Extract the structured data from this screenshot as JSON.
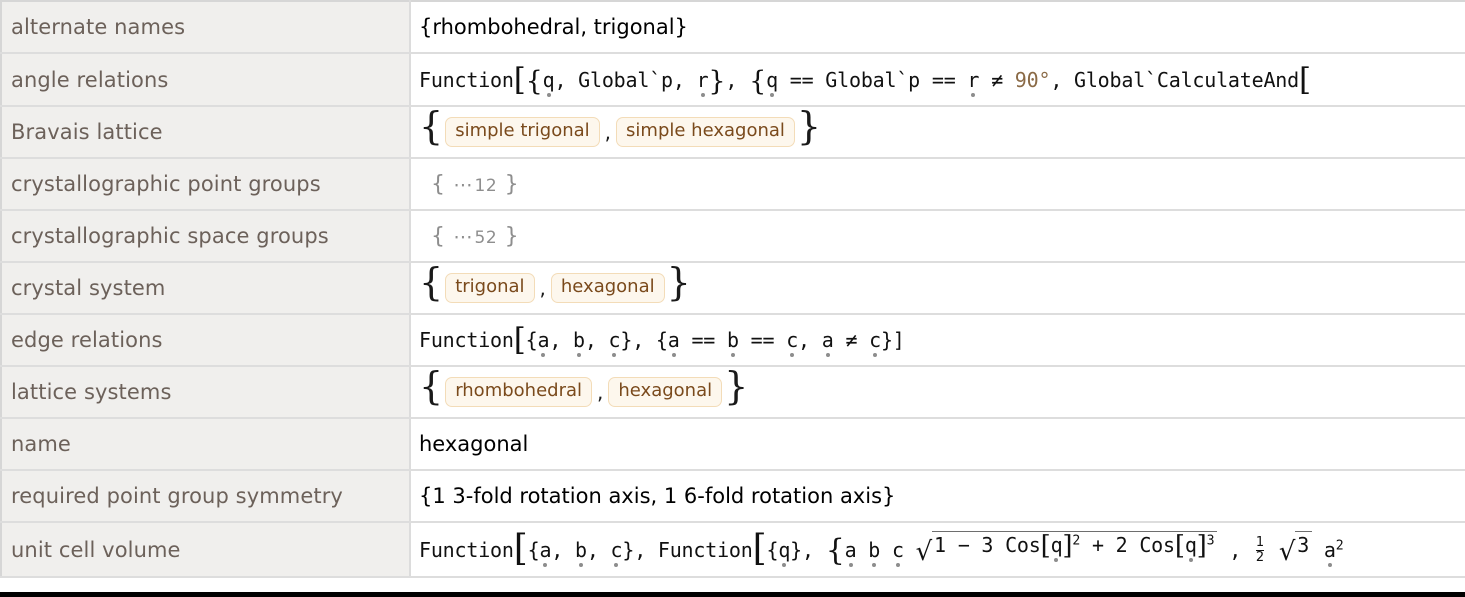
{
  "table": {
    "rows": [
      {
        "label": "alternate names",
        "kind": "plain-sans",
        "value": "{rhombohedral, trigonal}"
      },
      {
        "label": "angle relations",
        "kind": "function-angle",
        "value": "Function[{q, Global`p, r}, {q == Global`p == r ≠ 90°, Global`CalculateAnd[",
        "parts": {
          "head": "Function",
          "bracket_open": "[",
          "brace_open": "{",
          "v1": "q",
          "sep1": ", ",
          "global_p": "Global`p",
          "sep2": ", ",
          "v2": "r",
          "brace_close": "}",
          "sep3": ", ",
          "brace2_open": "{",
          "v3": "q",
          "eq1": "==",
          "global_p2": "Global`p",
          "eq2": "==",
          "v4": "r",
          "neq": "≠",
          "degree": "90°",
          "sep4": ", ",
          "tail": "Global`CalculateAnd",
          "bracket_open2": "["
        }
      },
      {
        "label": "Bravais lattice",
        "kind": "pill-list",
        "pills": [
          "simple trigonal",
          "simple hexagonal"
        ]
      },
      {
        "label": "crystallographic point groups",
        "kind": "collapsed",
        "count": "12"
      },
      {
        "label": "crystallographic space groups",
        "kind": "collapsed",
        "count": "52"
      },
      {
        "label": "crystal system",
        "kind": "pill-list",
        "pills": [
          "trigonal",
          "hexagonal"
        ]
      },
      {
        "label": "edge relations",
        "kind": "function-edge",
        "value": "Function[{a, b, c}, {a == b == c, a ≠ c}]",
        "parts": {
          "head": "Function",
          "bracket_open": "[",
          "brace_open": "{",
          "a1": "a",
          "b1": "b",
          "c1": "c",
          "brace_close": "}",
          "brace2_open": "{",
          "a2": "a",
          "eq1": "==",
          "b2": "b",
          "eq2": "==",
          "c2": "c",
          "comma": ",",
          "a3": "a",
          "neq": "≠",
          "c3": "c",
          "brace2_close": "}",
          "bracket_close": "]"
        }
      },
      {
        "label": "lattice systems",
        "kind": "pill-list",
        "pills": [
          "rhombohedral",
          "hexagonal"
        ]
      },
      {
        "label": "name",
        "kind": "plain-sans",
        "value": "hexagonal"
      },
      {
        "label": "required point group symmetry",
        "kind": "plain-sans",
        "value": "{1 3-fold rotation axis, 1 6-fold rotation axis}"
      },
      {
        "label": "unit cell volume",
        "kind": "function-volume",
        "value": "Function[{a, b, c}, Function[{q}, {a b c Sqrt[1 - 3 Cos[q]^2 + 2 Cos[q]^3], 1/2 Sqrt[3] a^2",
        "parts": {
          "head1": "Function",
          "bracket1": "[",
          "brace1": "{",
          "a1": "a",
          "b1": "b",
          "c1": "c",
          "brace1_close": "}",
          "comma1": ",",
          "head2": "Function",
          "bracket2": "[",
          "brace2": "{",
          "q1": "q",
          "brace2_close": "}",
          "comma2": ",",
          "brace3": "{",
          "ma": "a",
          "mb": "b",
          "mc": "c",
          "radicand_1": "1",
          "minus": "−",
          "radicand_3": "3",
          "cos1": "Cos",
          "cos1_br_open": "[",
          "cos1_var": "q",
          "cos1_br_close": "]",
          "cos1_exp": "2",
          "plus": "+",
          "radicand_2": "2",
          "cos2": "Cos",
          "cos2_br_open": "[",
          "cos2_var": "q",
          "cos2_br_close": "]",
          "cos2_exp": "3",
          "comma3": ",",
          "frac_num": "1",
          "frac_den": "2",
          "sqrt3": "3",
          "trail_a": "a",
          "trail_exp": "2"
        }
      }
    ]
  },
  "colors": {
    "label_text": "#6c615a",
    "label_bg": "#f0efed",
    "pill_bg": "#fdf7ed",
    "pill_border": "#f3dcb8",
    "pill_text": "#7a4a1c",
    "collapsed_text": "#8e8e8e",
    "degree_text": "#8a6a46",
    "grid_line": "#dddddd",
    "value_text": "#111111"
  }
}
